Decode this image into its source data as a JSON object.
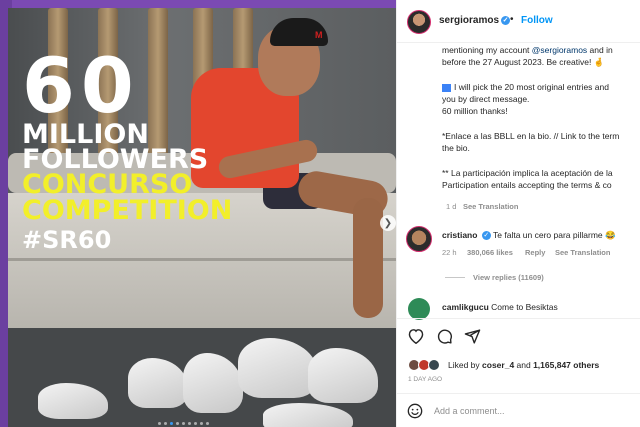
{
  "post": {
    "overlay": {
      "big_number": "60",
      "line1": "MILLION",
      "line2": "FOLLOWERS",
      "line3": "CONCURSO",
      "line4": "COMPETITION",
      "hashtag": "#SR60"
    },
    "cap_logo": "M",
    "carousel": {
      "dots": 9,
      "active_index": 2
    }
  },
  "header": {
    "username": "sergioramos",
    "separator": "•",
    "follow_label": "Follow"
  },
  "caption": {
    "line1_pre": "mentioning my account ",
    "line1_mention": "@sergioramos",
    "line1_post": " and in",
    "line2": "before the 27 August 2023. Be creative! 🤞",
    "line3": "I will pick the 20 most original entries and",
    "line4": "you by direct message.",
    "line5": "60 million thanks!",
    "line6": "*Enlace a las BBLL en la bio. // Link to the term",
    "line7": "the bio.",
    "line8": "** La participación implica la aceptación de la",
    "line9": "Participation entails accepting the terms & co",
    "time": "1 d",
    "see_translation": "See Translation"
  },
  "comments": [
    {
      "username": "cristiano",
      "text": "Te falta un cero para pillarme 😂",
      "time": "22 h",
      "likes": "380,066 likes",
      "reply": "Reply",
      "see_translation": "See Translation",
      "view_replies": "View replies (11609)"
    },
    {
      "username": "camlikgucu",
      "text": "Come to Besiktas"
    }
  ],
  "actions": {
    "liked_by_prefix": "Liked by ",
    "liked_by_user": "coser_4",
    "liked_by_and": " and ",
    "liked_by_count": "1,165,847 others",
    "timestamp": "1 DAY AGO"
  },
  "add_comment": {
    "placeholder": "Add a comment..."
  },
  "colors": {
    "accent": "#0095f6",
    "verified": "#3897f0",
    "headline_yellow": "#f2ef2a",
    "shirt_red": "#e3462e"
  }
}
